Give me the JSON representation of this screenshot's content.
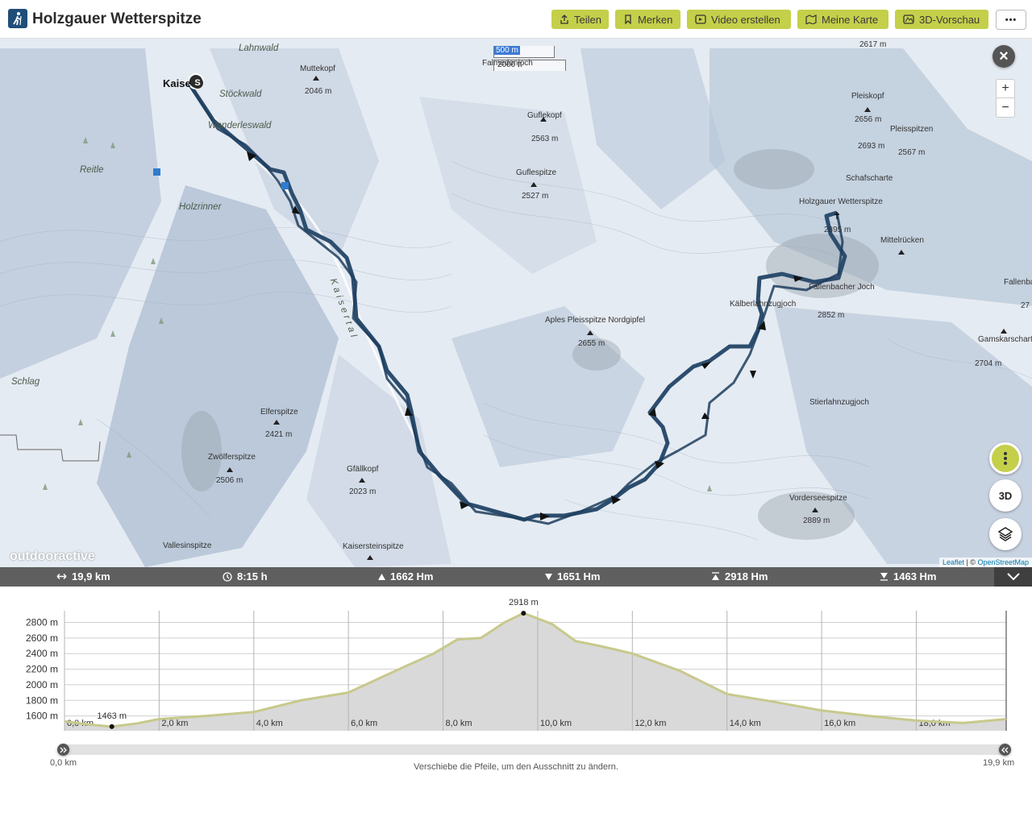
{
  "header": {
    "title": "Holzgauer Wetterspitze",
    "buttons": {
      "share": "Teilen",
      "bookmark": "Merken",
      "video": "Video erstellen",
      "mymap": "Meine Karte",
      "preview3d": "3D-Vorschau"
    },
    "more": "•••"
  },
  "map": {
    "scale": {
      "metric": "500 m",
      "imperial": "2000 ft"
    },
    "zoom_in": "+",
    "zoom_out": "−",
    "close": "×",
    "btn_3d": "3D",
    "watermark": "outdooractive",
    "attribution": {
      "leaflet": "Leaflet",
      "sep": " | © ",
      "osm": "OpenStreetMap"
    },
    "start_marker": "S",
    "labels": {
      "lahnwald": "Lahnwald",
      "muttekopf": "Muttekopf",
      "muttekopf_alt": "2046 m",
      "kaisers": "Kaise",
      "stoeckwald": "Stöckwald",
      "wanderleswald": "Wanderleswald",
      "falmedonjoch": "Falmedonjoch",
      "guflekopf": "Guflekopf",
      "guflekopf_alt": "2563 m",
      "guflespitze": "Guflespitze",
      "guflespitze_alt": "2527 m",
      "reitle": "Reitle",
      "holzrinner": "Holzrinner",
      "kaisertal": "Kaisertal",
      "schlag": "Schlag",
      "elferspitze": "Elferspitze",
      "elferspitze_alt": "2421 m",
      "zwoelferspitze": "Zwölferspitze",
      "zwoelferspitze_alt": "2506 m",
      "gfaellkopf": "Gfällkopf",
      "gfaellkopf_alt": "2023 m",
      "vallesinspitze": "Vallesinspitze",
      "kaisersteinspitze": "Kaisersteinspitze",
      "aples": "Aples Pleisspitze Nordgipfel",
      "aples_alt": "2655 m",
      "pleiskopf": "Pleiskopf",
      "pleiskopf_alt": "2656 m",
      "pleisspitzen": "Pleisspitzen",
      "pleisspitzen_alt": "2567 m",
      "alt_2693": "2693 m",
      "schafscharte": "Schafscharte",
      "wetterspitze": "Holzgauer Wetterspitze",
      "wetterspitze_alt": "2895 m",
      "mittelruecken": "Mittelrücken",
      "fallenbacher": "Fallenbacher Joch",
      "kaelberlahn": "Kälberlahnzugjoch",
      "alt_2852": "2852 m",
      "fallenba": "Fallenba",
      "alt_27": "27",
      "gamskarscharte": "Gamskarscharte",
      "gamskarscharte_alt": "2704 m",
      "stierlahnzugjoch": "Stierlahnzugjoch",
      "vorderseespitze": "Vorderseespitze",
      "vorderseespitze_alt": "2889 m",
      "alt_2617": "2617 m"
    }
  },
  "stats": {
    "distance": "19,9 km",
    "duration": "8:15 h",
    "ascent": "1662 Hm",
    "descent": "1651 Hm",
    "max_alt": "2918 Hm",
    "min_alt": "1463 Hm"
  },
  "chart_data": {
    "type": "area",
    "x": [
      0.0,
      0.5,
      1.0,
      1.5,
      2.0,
      3.0,
      4.0,
      5.0,
      6.0,
      7.0,
      7.8,
      8.3,
      8.8,
      9.3,
      9.7,
      10.3,
      10.8,
      11.3,
      12.0,
      13.0,
      14.0,
      15.0,
      16.0,
      17.0,
      18.0,
      19.0,
      19.9
    ],
    "y": [
      1530,
      1490,
      1463,
      1500,
      1560,
      1600,
      1650,
      1800,
      1900,
      2180,
      2400,
      2580,
      2600,
      2800,
      2918,
      2780,
      2560,
      2500,
      2400,
      2180,
      1880,
      1780,
      1670,
      1600,
      1540,
      1510,
      1560
    ],
    "peak_label": "2918 m",
    "low_label": "1463 m",
    "ytick_labels": [
      "2800 m",
      "2600 m",
      "2400 m",
      "2200 m",
      "2000 m",
      "1800 m",
      "1600 m"
    ],
    "yticks": [
      2800,
      2600,
      2400,
      2200,
      2000,
      1800,
      1600
    ],
    "xtick_labels": [
      "0,0 km",
      "2,0 km",
      "4,0 km",
      "6,0 km",
      "8,0 km",
      "10,0 km",
      "12,0 km",
      "14,0 km",
      "16,0 km",
      "18,0 km"
    ],
    "xticks": [
      0,
      2,
      4,
      6,
      8,
      10,
      12,
      14,
      16,
      18
    ],
    "xlim": [
      0,
      19.9
    ],
    "ylim": [
      1410,
      2950
    ],
    "fill_color": "#d9d9d9",
    "line_color": "#c8c98c"
  },
  "range": {
    "start": "0,0 km",
    "end": "19,9 km",
    "hint": "Verschiebe die Pfeile, um den Ausschnitt zu ändern."
  }
}
